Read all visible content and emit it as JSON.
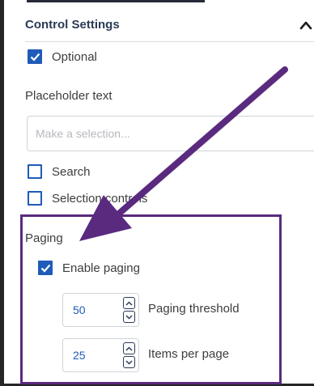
{
  "panel": {
    "title": "Control Settings"
  },
  "optional": {
    "label": "Optional",
    "checked": true
  },
  "placeholder": {
    "label": "Placeholder text",
    "value": "",
    "placeholder": "Make a selection..."
  },
  "search": {
    "label": "Search",
    "checked": false
  },
  "selection_controls": {
    "label": "Selection controls",
    "checked": false
  },
  "paging": {
    "section_label": "Paging",
    "enable": {
      "label": "Enable paging",
      "checked": true
    },
    "threshold": {
      "value": "50",
      "label": "Paging threshold"
    },
    "items_per_page": {
      "value": "25",
      "label": "Items per page"
    }
  },
  "colors": {
    "accent": "#1f5bb8",
    "annotation": "#5a2a7f",
    "header_text": "#2b3a58"
  }
}
